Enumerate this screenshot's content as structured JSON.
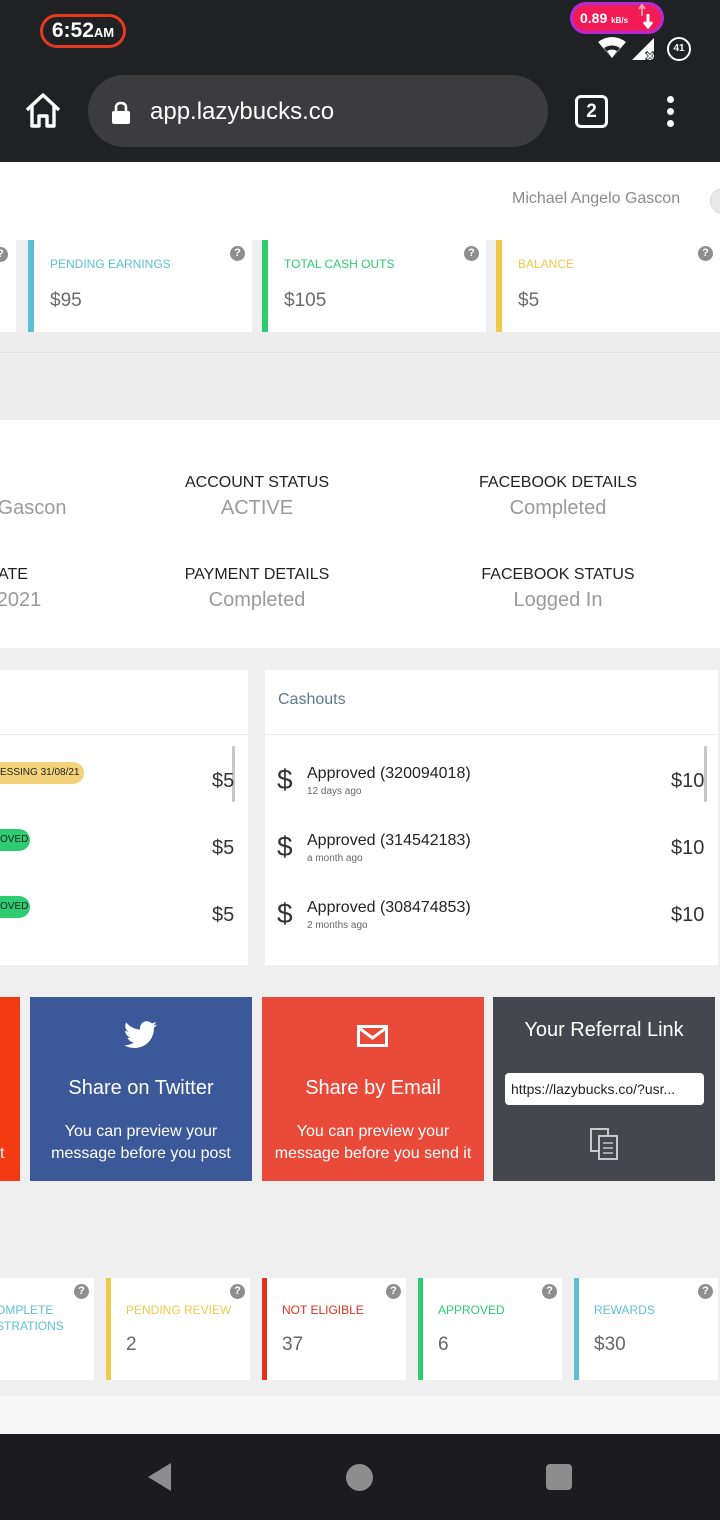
{
  "status_bar": {
    "time": "6:52",
    "ampm": "AM",
    "net_speed": "0.89",
    "net_unit": "kB/s",
    "battery": "41"
  },
  "browser": {
    "url": "app.lazybucks.co",
    "tab_count": "2"
  },
  "header": {
    "user_name": "Michael Angelo Gascon"
  },
  "top_stats": [
    {
      "label": "PENDING EARNINGS",
      "value": "$95",
      "color": "#5bc0d6"
    },
    {
      "label": "TOTAL CASH OUTS",
      "value": "$105",
      "color": "#2ecc71"
    },
    {
      "label": "BALANCE",
      "value": "$5",
      "color": "#f0c84a"
    }
  ],
  "account": {
    "name_partial": "Gascon",
    "date_label_partial": "ATE",
    "date_value_partial": "2021",
    "account_status_label": "ACCOUNT STATUS",
    "account_status_value": "ACTIVE",
    "facebook_details_label": "FACEBOOK DETAILS",
    "facebook_details_value": "Completed",
    "payment_details_label": "PAYMENT DETAILS",
    "payment_details_value": "Completed",
    "facebook_status_label": "FACEBOOK STATUS",
    "facebook_status_value": "Logged In"
  },
  "earnings": [
    {
      "tag": "ESSING 31/08/21",
      "tag_color": "#f3d27a",
      "amount": "$5"
    },
    {
      "tag": "OVED",
      "tag_color": "#2ecc71",
      "amount": "$5"
    },
    {
      "tag": "OVED",
      "tag_color": "#2ecc71",
      "amount": "$5"
    }
  ],
  "cashouts": {
    "title": "Cashouts",
    "items": [
      {
        "label": "Approved (320094018)",
        "time": "12 days ago",
        "amount": "$10"
      },
      {
        "label": "Approved (314542183)",
        "time": "a month ago",
        "amount": "$10"
      },
      {
        "label": "Approved (308474853)",
        "time": "2 months ago",
        "amount": "$10"
      }
    ]
  },
  "share": {
    "left_partial": "t",
    "twitter_title": "Share on Twitter",
    "twitter_desc_1": "You can preview your",
    "twitter_desc_2": "message before you post",
    "email_title": "Share by Email",
    "email_desc_1": "You can preview your",
    "email_desc_2": "message before you send it",
    "referral_title": "Your Referral Link",
    "referral_url": "https://lazybucks.co/?usr..."
  },
  "bottom_stats": [
    {
      "label_1": "OMPLETE",
      "label_2": "STRATIONS",
      "value": "",
      "color": "#5bc0d6"
    },
    {
      "label_1": "PENDING REVIEW",
      "label_2": "",
      "value": "2",
      "color": "#f0c84a"
    },
    {
      "label_1": "NOT ELIGIBLE",
      "label_2": "",
      "value": "37",
      "color": "#e0321c"
    },
    {
      "label_1": "APPROVED",
      "label_2": "",
      "value": "6",
      "color": "#2ecc71"
    },
    {
      "label_1": "REWARDS",
      "label_2": "",
      "value": "$30",
      "color": "#5bc0d6"
    }
  ],
  "colors": {
    "twitter": "#3b5998",
    "email": "#e94a3a",
    "referral": "#45474f",
    "left_tile": "#f13a12"
  }
}
